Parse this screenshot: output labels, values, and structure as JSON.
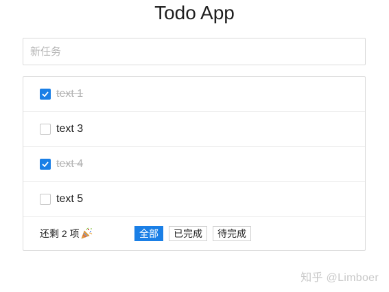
{
  "title": "Todo App",
  "new_task": {
    "placeholder": "新任务",
    "value": ""
  },
  "todos": [
    {
      "text": "text 1",
      "done": true
    },
    {
      "text": "text 3",
      "done": false
    },
    {
      "text": "text 4",
      "done": true
    },
    {
      "text": "text 5",
      "done": false
    }
  ],
  "footer": {
    "remaining": "还剩 2 项",
    "remaining_icon": "party-popper-icon",
    "filters": [
      {
        "label": "全部",
        "active": true
      },
      {
        "label": "已完成",
        "active": false
      },
      {
        "label": "待完成",
        "active": false
      }
    ]
  },
  "watermark": "知乎 @Limboer",
  "colors": {
    "accent": "#1a7fe6",
    "done_text": "#b3b3b3",
    "border": "#dcdcdc"
  }
}
